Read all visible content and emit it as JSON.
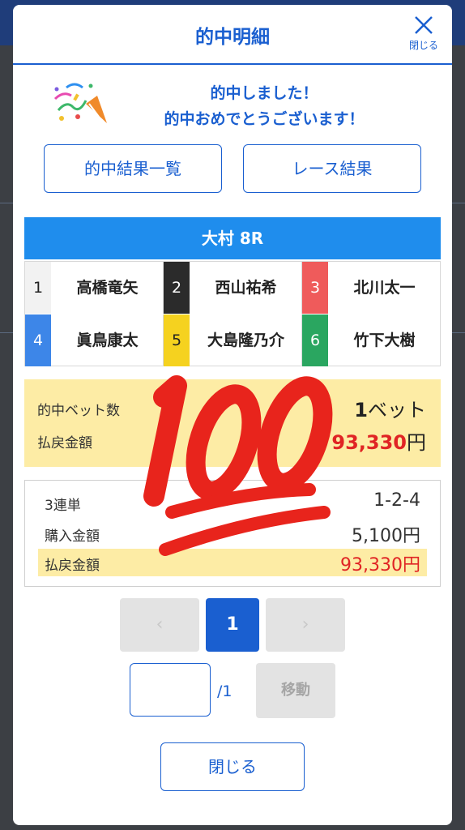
{
  "modal": {
    "title": "的中明細",
    "close_icon_label": "閉じる"
  },
  "congrats": {
    "line1": "的中しました！",
    "line2": "的中おめでとうございます！"
  },
  "buttons": {
    "results_list": "的中結果一覧",
    "race_results": "レース結果",
    "close": "閉じる",
    "move": "移動"
  },
  "race": {
    "name": "大村 8R",
    "racers": [
      {
        "num": "1",
        "name": "高橋竜矢",
        "num_bg": "#f2f2f2",
        "num_color": "#222222"
      },
      {
        "num": "2",
        "name": "西山祐希",
        "num_bg": "#2b2b2b",
        "num_color": "#ffffff"
      },
      {
        "num": "3",
        "name": "北川太一",
        "num_bg": "#ef5b5b",
        "num_color": "#ffffff"
      },
      {
        "num": "4",
        "name": "眞鳥康太",
        "num_bg": "#3d86e8",
        "num_color": "#ffffff"
      },
      {
        "num": "5",
        "name": "大島隆乃介",
        "num_bg": "#f5d21f",
        "num_color": "#222222"
      },
      {
        "num": "6",
        "name": "竹下大樹",
        "num_bg": "#2aa660",
        "num_color": "#ffffff"
      }
    ]
  },
  "summary": {
    "bets_label": "的中ベット数",
    "bets_value_num": "1",
    "bets_value_unit": "ベット",
    "payout_label": "払戻金額",
    "payout_value": "93,330",
    "payout_unit": "円"
  },
  "detail": {
    "type_label": "3連単",
    "type_value": "1-2-4",
    "purchase_label": "購入金額",
    "purchase_value": "5,100円",
    "payout_label": "払戻金額",
    "payout_value": "93,330円"
  },
  "pagination": {
    "prev": "‹",
    "current": "1",
    "next": "›",
    "input_value": "",
    "total": "/1"
  },
  "overlay": {
    "emoji": "100",
    "emoji_name": "hundred-points-emoji"
  },
  "colors": {
    "accent": "#1a5fd0",
    "race_bar": "#1f8ded",
    "highlight": "#fdeca5",
    "payout_red": "#e02424",
    "emoji_red": "#e8241c"
  }
}
